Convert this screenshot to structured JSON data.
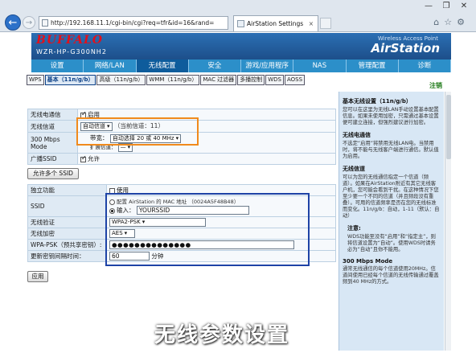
{
  "browser": {
    "url": "http://192.168.11.1/cgi-bin/cgi?req=tfr&id=16&rand=",
    "tab_title": "AirStation Settings",
    "back_glyph": "←",
    "forward_glyph": "→",
    "close_glyph": "×",
    "window_controls": [
      "—",
      "❐",
      "✕"
    ],
    "right_icons": "⌂☆⚙"
  },
  "router": {
    "brand": "BUFFALO",
    "model": "WZR-HP-G300NH2",
    "product_line": "Wireless Access Point",
    "product_name": "AirStation"
  },
  "nav": {
    "items": [
      "设置",
      "网络/LAN",
      "无线配置",
      "安全",
      "游戏/应用程序",
      "NAS",
      "管理配置",
      "诊断"
    ],
    "active_index": 2
  },
  "subnav": {
    "items": [
      "WPS",
      "基本（11n/g/b）",
      "高级（11n/g/b）",
      "WMM（11n/g/b）",
      "MAC 过滤器",
      "多播控制",
      "WDS",
      "AOSS"
    ],
    "active_index": 1
  },
  "note_label": "注销",
  "form": {
    "rows": {
      "wireless_channel_enable": {
        "label": "无线电通信",
        "value": "启用"
      },
      "channel": {
        "label": "无线信道",
        "selected": "自动信道",
        "current": "（当前信道：11）"
      },
      "mode_300": {
        "label": "300 Mbps Mode",
        "band_label": "带宽：",
        "band_selected": "自动选择 20 或 40 MHz",
        "ext_label": "扩展信道：",
        "ext_selected": "—"
      },
      "broadcast_ssid": {
        "label": "广播SSID",
        "value": "允许"
      },
      "multi_ssid_button": "允许多个 SSID",
      "separate": {
        "label": "独立功能",
        "value": "使用"
      },
      "ssid": {
        "label": "SSID",
        "option1": "配置 AirStation 的 MAC 地址 （0024A5F48B48）",
        "option2_prefix": "输入：",
        "option2_value": "YOURSSID"
      },
      "auth": {
        "label": "无线验证",
        "selected": "WPA2-PSK"
      },
      "encryption": {
        "label": "无线加密",
        "selected": "AES"
      },
      "psk": {
        "label": "WPA-PSK（预共享密钥）:",
        "value": "●●●●●●●●●●●●●●"
      },
      "rekey": {
        "label": "更新密钥间隔时间：",
        "value": "60",
        "unit": "分钟"
      },
      "apply_button": "应用"
    }
  },
  "help": {
    "title": "基本无线设置（11n/g/b）",
    "intro": "您可以在这里为无线LAN手动设置基本配置信息。如果未使用加密，只需通过基本设置便可建立连接，但强烈建议进行加密。",
    "sections": [
      {
        "title": "无线电通信",
        "text": "不选定“启用”将禁用无线LAN电。当禁用时，将不能与无线客户端进行通信。默认值为启用。"
      },
      {
        "title": "无线信道",
        "text": "可以为您的无线通信指定一个信道（频道）。如果在AirStation附近有其它无线客户机，您可能会看到干扰。在这种情况下您至少要一个不同的信道（并且频段没有重叠）。可用的信道频率是否在您的无线标准而变化。11n/g/b：自动，1-11（默认：自动）"
      },
      {
        "title": "注意:",
        "text": "WDS功能至没有“启用”和“指定主”，则将信道设置为“自动”。使用WDS时请务必为“自动”且你不能用。"
      },
      {
        "title": "300 Mbps Mode",
        "text": "通常无线通信的每个信道使用20MHz。信道间使用已经每个信道的无线传输通过覆盖频到40 MHz的方式。"
      }
    ]
  },
  "caption": "无线参数设置",
  "colors": {
    "header_blue": "#1d4f8a",
    "nav_blue": "#2c8fc9",
    "highlight_orange": "#f08a1c",
    "highlight_blue": "#1e43a6",
    "brand_red": "#e3101a"
  }
}
